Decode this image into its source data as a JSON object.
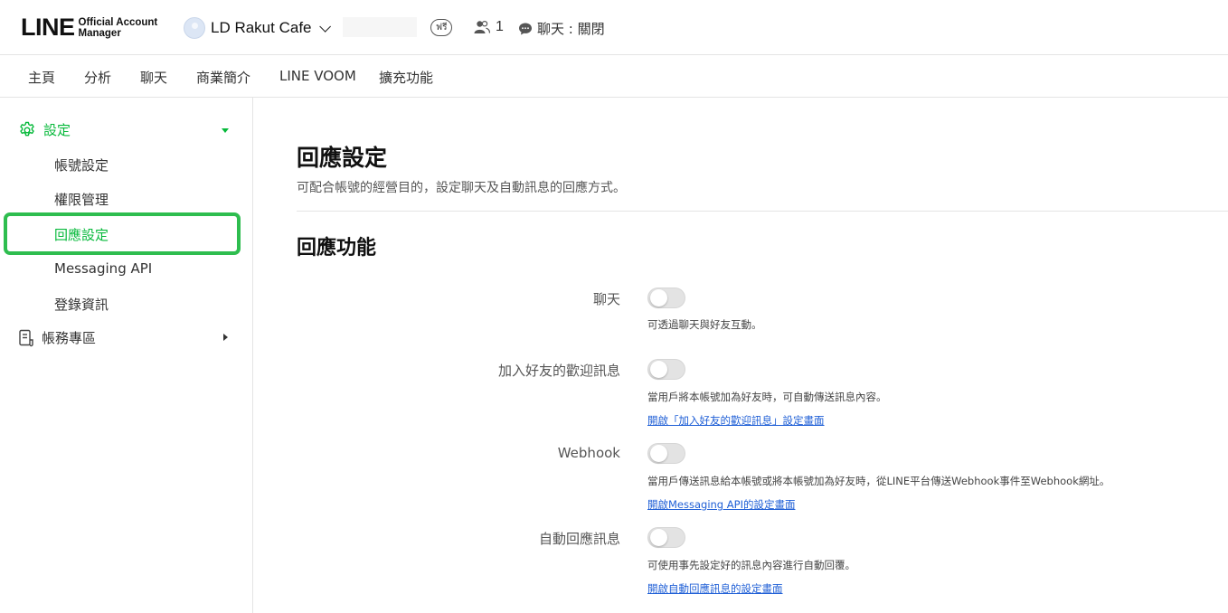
{
  "header": {
    "logo_main": "LINE",
    "logo_sub_line1": "Official Account",
    "logo_sub_line2": "Manager",
    "account_name": "LD Rakut Cafe",
    "plan_badge": "ฟรี",
    "friend_count": "1",
    "chat_status": "聊天 : 關閉"
  },
  "nav": {
    "tabs": [
      {
        "label": "主頁"
      },
      {
        "label": "分析"
      },
      {
        "label": "聊天"
      },
      {
        "label": "商業簡介"
      },
      {
        "label": "LINE VOOM"
      },
      {
        "label": "擴充功能"
      }
    ]
  },
  "sidebar": {
    "settings_label": "設定",
    "items": [
      {
        "label": "帳號設定"
      },
      {
        "label": "權限管理"
      },
      {
        "label": "回應設定"
      },
      {
        "label": "Messaging API"
      },
      {
        "label": "登錄資訊"
      }
    ],
    "billing_label": "帳務專區"
  },
  "main": {
    "title": "回應設定",
    "description": "可配合帳號的經營目的，設定聊天及自動訊息的回應方式。",
    "section_title": "回應功能",
    "settings": [
      {
        "label": "聊天",
        "enabled": false,
        "description": "可透過聊天與好友互動。",
        "link": ""
      },
      {
        "label": "加入好友的歡迎訊息",
        "enabled": false,
        "description": "當用戶將本帳號加為好友時，可自動傳送訊息內容。",
        "link": "開啟「加入好友的歡迎訊息」設定畫面"
      },
      {
        "label": "Webhook",
        "enabled": false,
        "description": "當用戶傳送訊息給本帳號或將本帳號加為好友時，從LINE平台傳送Webhook事件至Webhook網址。",
        "link": "開啟Messaging API的設定畫面"
      },
      {
        "label": "自動回應訊息",
        "enabled": false,
        "description": "可使用事先設定好的訊息內容進行自動回覆。",
        "link": "開啟自動回應訊息的設定畫面"
      }
    ]
  },
  "colors": {
    "accent_green": "#06b93a",
    "highlight_outline": "#2ebd4f",
    "link_blue": "#1f5fd6"
  }
}
